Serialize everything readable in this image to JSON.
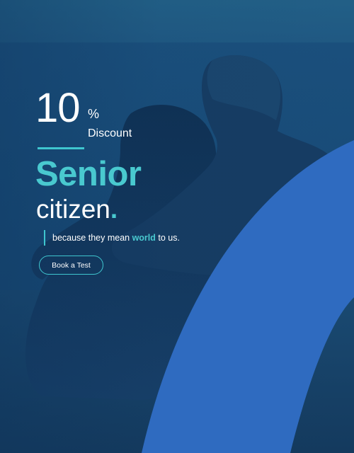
{
  "banner": {
    "percent_value": "10",
    "percent_sign": "%",
    "discount_label": "Discount",
    "title_line1": "Senior",
    "title_line2": "citizen",
    "title_dot": ".",
    "tagline_before": "because they mean ",
    "tagline_highlight": "world",
    "tagline_after": " to us.",
    "cta_label": "Book a Test"
  },
  "colors": {
    "background": "#174a78",
    "accent": "#49c9cf",
    "arc": "#2f6bc0",
    "text": "#ffffff"
  },
  "images": {
    "photo": "elderly-couple-sitting-on-beach-back-view"
  }
}
